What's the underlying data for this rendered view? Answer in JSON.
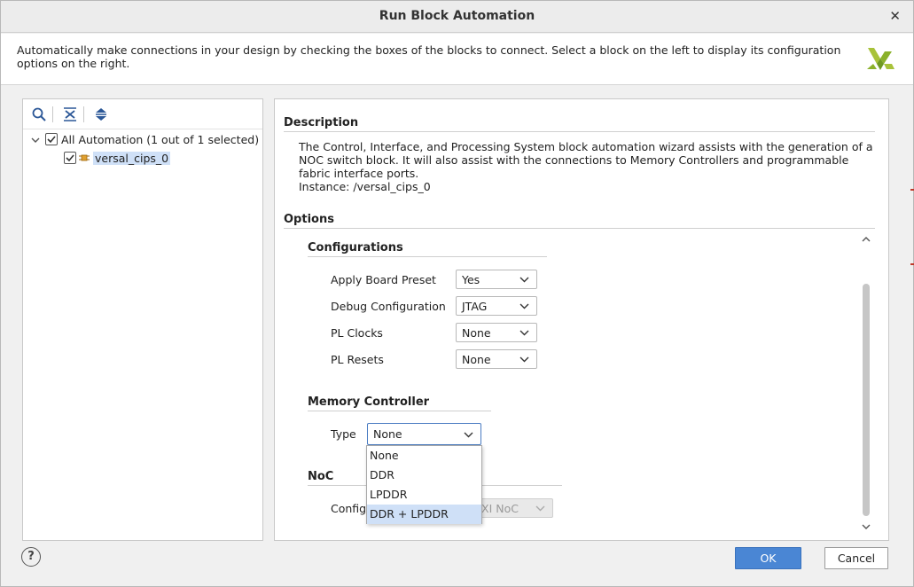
{
  "window": {
    "title": "Run Block Automation",
    "close_glyph": "✕"
  },
  "info": {
    "text": "Automatically make connections in your design by checking the boxes of the blocks to connect. Select a block on the left to display its configuration options on the right."
  },
  "tree": {
    "toolbar_icons": [
      "search-icon",
      "collapse-all-icon",
      "expand-all-icon"
    ],
    "root": {
      "label": "All Automation (1 out of 1 selected)",
      "checked": true
    },
    "child": {
      "label": "versal_cips_0",
      "checked": true
    }
  },
  "description": {
    "heading": "Description",
    "text": "The Control, Interface, and Processing System block automation wizard assists with the generation of a NOC switch block. It will also assist with the connections to Memory Controllers and programmable fabric interface ports.",
    "instance": "Instance: /versal_cips_0"
  },
  "options": {
    "heading": "Options",
    "configurations": {
      "heading": "Configurations",
      "fields": [
        {
          "label": "Apply Board Preset",
          "value": "Yes"
        },
        {
          "label": "Debug Configuration",
          "value": "JTAG"
        },
        {
          "label": "PL Clocks",
          "value": "None"
        },
        {
          "label": "PL Resets",
          "value": "None"
        }
      ]
    },
    "memory_controller": {
      "heading": "Memory Controller",
      "type_label": "Type",
      "type_value": "None",
      "dropdown_options": [
        "None",
        "DDR",
        "LPDDR",
        "DDR + LPDDR"
      ],
      "highlighted_option": "DDR + LPDDR"
    },
    "noc": {
      "heading": "NoC",
      "config_label": "Config",
      "config_value": "XI NoC"
    }
  },
  "buttons": {
    "help": "?",
    "ok": "OK",
    "cancel": "Cancel"
  },
  "colors": {
    "accent": "#4a86d4",
    "selection": "#cfe0f7"
  }
}
